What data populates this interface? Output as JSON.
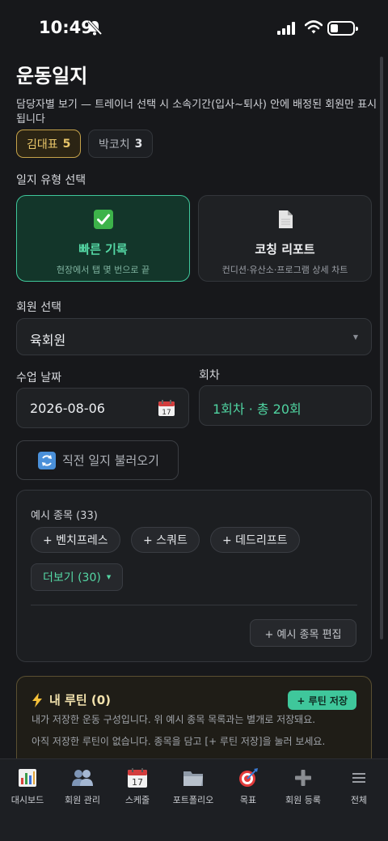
{
  "status": {
    "time": "10:49"
  },
  "page": {
    "title": "운동일지",
    "description": "담당자별 보기 — 트레이너 선택 시 소속기간(입사~퇴사) 안에 배정된 회원만 표시됩니다"
  },
  "trainers": [
    {
      "name": "김대표",
      "count": "5",
      "selected": true
    },
    {
      "name": "박코치",
      "count": "3",
      "selected": false
    }
  ],
  "log_type": {
    "label": "일지 유형 선택",
    "options": [
      {
        "title": "빠른 기록",
        "sub": "현장에서 탭 몇 번으로 끝",
        "icon": "check-mark-icon",
        "selected": true
      },
      {
        "title": "코칭 리포트",
        "sub": "컨디션·유산소·프로그램 상세 차트",
        "icon": "document-icon",
        "selected": false
      }
    ]
  },
  "member": {
    "label": "회원 선택",
    "value": "육회원"
  },
  "class_date": {
    "label": "수업 날짜",
    "value": "2026-08-06"
  },
  "session": {
    "label": "회차",
    "value": "1회차 · 총 20회"
  },
  "load_prev": {
    "label": "직전 일지 불러오기"
  },
  "examples": {
    "title": "예시 종목 (33)",
    "items": [
      "+ 벤치프레스",
      "+ 스쿼트",
      "+ 데드리프트"
    ],
    "more": "더보기 (30)",
    "edit": "+ 예시 종목 편집"
  },
  "routine": {
    "title": "내 루틴 (0)",
    "save": "+ 루틴 저장",
    "desc": "내가 저장한 운동 구성입니다. 위 예시 종목 목록과는 별개로 저장돼요.",
    "empty": "아직 저장한 루틴이 없습니다. 종목을 담고 [+ 루틴 저장]을 눌러 보세요."
  },
  "tabs": [
    {
      "label": "대시보드",
      "icon": "bar-chart-icon"
    },
    {
      "label": "회원 관리",
      "icon": "people-icon"
    },
    {
      "label": "스케줄",
      "icon": "calendar-icon"
    },
    {
      "label": "포트폴리오",
      "icon": "folder-icon"
    },
    {
      "label": "목표",
      "icon": "target-icon"
    },
    {
      "label": "회원 등록",
      "icon": "plus-icon"
    },
    {
      "label": "전체",
      "icon": "menu-icon"
    }
  ],
  "colors": {
    "accent": "#3fc79b",
    "gold": "#e9c66a",
    "background": "#17181b"
  }
}
